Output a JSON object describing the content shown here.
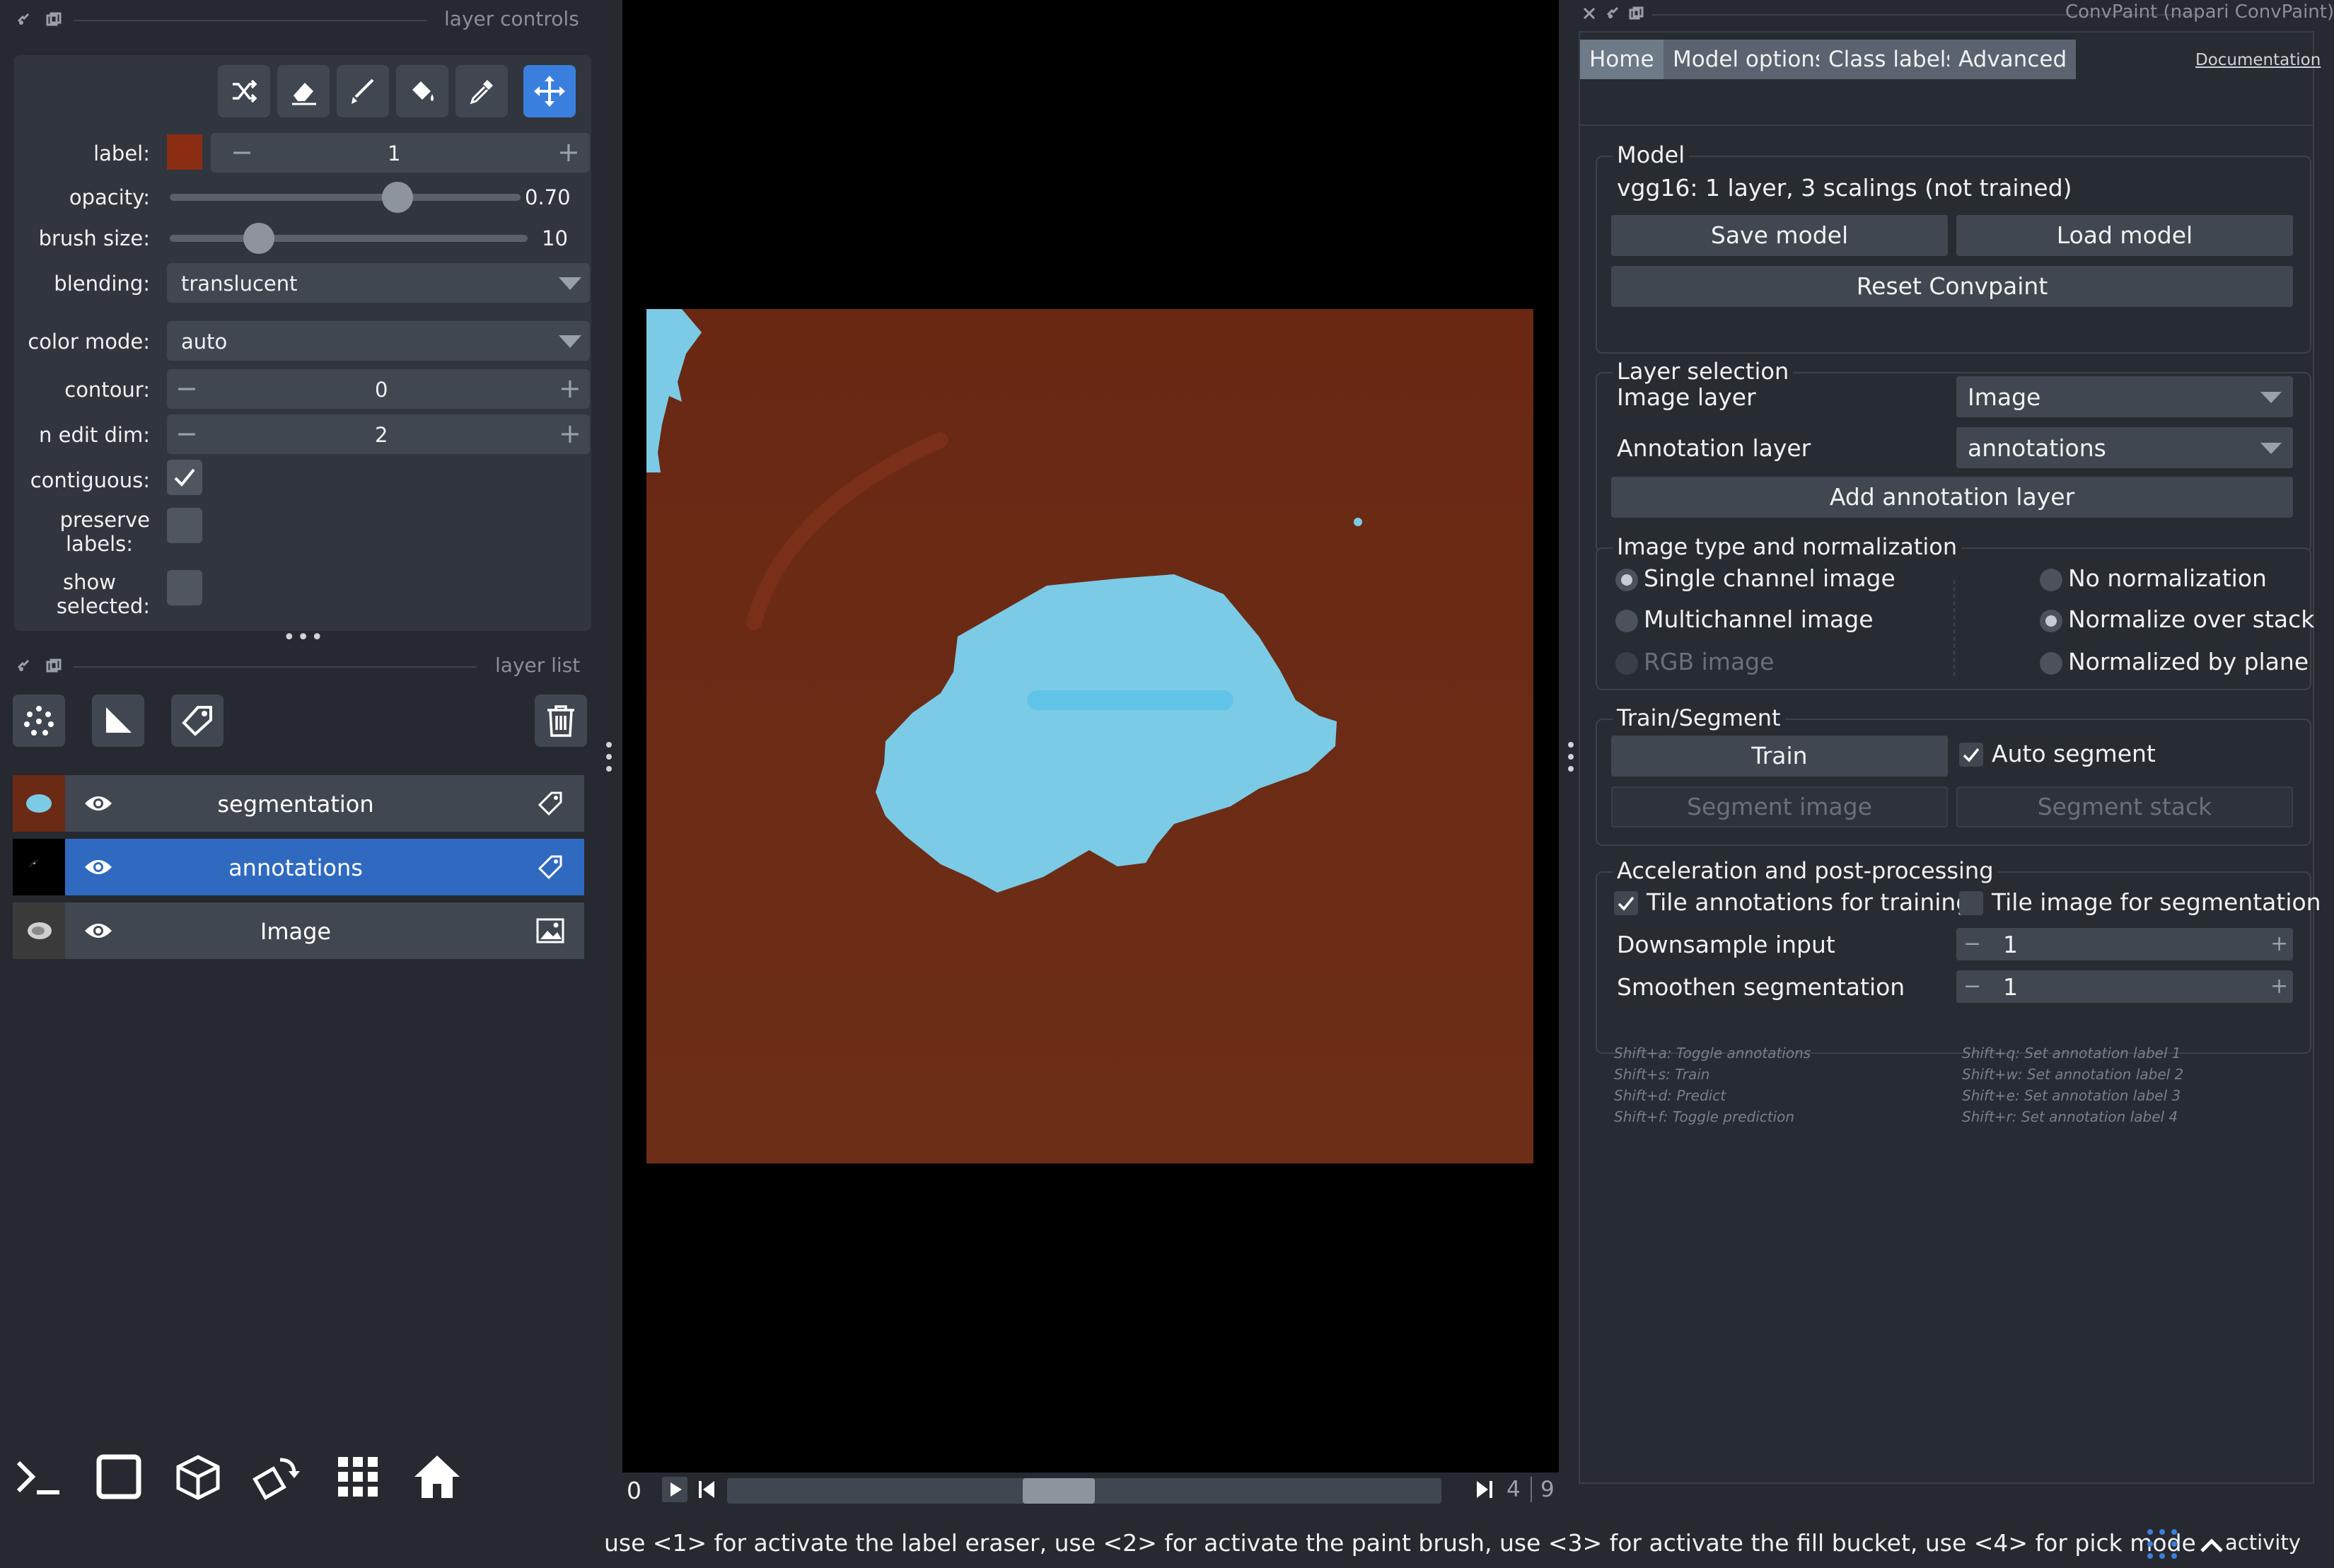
{
  "layer_controls": {
    "dock_title": "layer controls",
    "label_label": "label:",
    "label_value": "1",
    "label_color": "#8a2d12",
    "opacity_label": "opacity:",
    "opacity_value": "0.70",
    "opacity_level": 0.7,
    "brush_size_label": "brush size:",
    "brush_size_value": "10",
    "blending_label": "blending:",
    "blending_value": "translucent",
    "color_mode_label": "color mode:",
    "color_mode_value": "auto",
    "contour_label": "contour:",
    "contour_value": "0",
    "n_edit_dim_label": "n edit dim:",
    "n_edit_dim_value": "2",
    "contiguous_label": "contiguous:",
    "contiguous_checked": true,
    "preserve_labels_label_1": "preserve",
    "preserve_labels_label_2": "labels:",
    "show_selected_label_1": "show",
    "show_selected_label_2": "selected:",
    "tools": [
      "shuffle-icon",
      "eraser-icon",
      "paint-brush-icon",
      "fill-bucket-icon",
      "color-picker-icon",
      "pan-zoom-icon"
    ]
  },
  "layer_list": {
    "dock_title": "layer list",
    "layers": [
      {
        "name": "segmentation",
        "type": "labels",
        "visible": true,
        "selected": false
      },
      {
        "name": "annotations",
        "type": "labels",
        "visible": true,
        "selected": true
      },
      {
        "name": "Image",
        "type": "image",
        "visible": true,
        "selected": false
      }
    ]
  },
  "viewer": {
    "background": "#000000",
    "image_color": "#6b2a14",
    "segment_color": "#7ccbe6",
    "slider": {
      "current_left": "0",
      "current_value": "4",
      "total": "9"
    }
  },
  "plugin": {
    "title": "ConvPaint (napari ConvPaint)",
    "tabs": [
      "Home",
      "Model options",
      "Class labels",
      "Advanced"
    ],
    "documentation_link": "Documentation",
    "model": {
      "title": "Model",
      "description": "vgg16: 1 layer, 3 scalings (not trained)",
      "save": "Save model",
      "load": "Load model",
      "reset": "Reset Convpaint"
    },
    "layer_selection": {
      "title": "Layer selection",
      "image_layer_label": "Image layer",
      "image_layer_value": "Image",
      "annotation_layer_label": "Annotation layer",
      "annotation_layer_value": "annotations",
      "add_button": "Add annotation layer"
    },
    "image_type": {
      "title": "Image type and normalization",
      "single_channel": "Single channel image",
      "multichannel": "Multichannel image",
      "rgb": "RGB image",
      "no_norm": "No normalization",
      "norm_stack": "Normalize over stack",
      "norm_plane": "Normalized by plane"
    },
    "train_segment": {
      "title": "Train/Segment",
      "train": "Train",
      "auto_segment": "Auto segment",
      "segment_image": "Segment image",
      "segment_stack": "Segment stack"
    },
    "acceleration": {
      "title": "Acceleration and post-processing",
      "tile_annotations": "Tile annotations for training",
      "tile_image": "Tile image for segmentation",
      "downsample_label": "Downsample input",
      "downsample_value": "1",
      "smoothen_label": "Smoothen segmentation",
      "smoothen_value": "1"
    },
    "shortcuts_left": [
      "Shift+a: Toggle annotations",
      "Shift+s: Train",
      "Shift+d: Predict",
      "Shift+f: Toggle prediction"
    ],
    "shortcuts_right": [
      "Shift+q: Set annotation label 1",
      "Shift+w: Set annotation label 2",
      "Shift+e: Set annotation label 3",
      "Shift+r: Set annotation label 4"
    ]
  },
  "status_bar": {
    "message": "use <1> for activate the label eraser, use <2> for activate the paint brush, use <3> for activate the fill bucket, use <4> for pick mode",
    "activity": "activity"
  }
}
